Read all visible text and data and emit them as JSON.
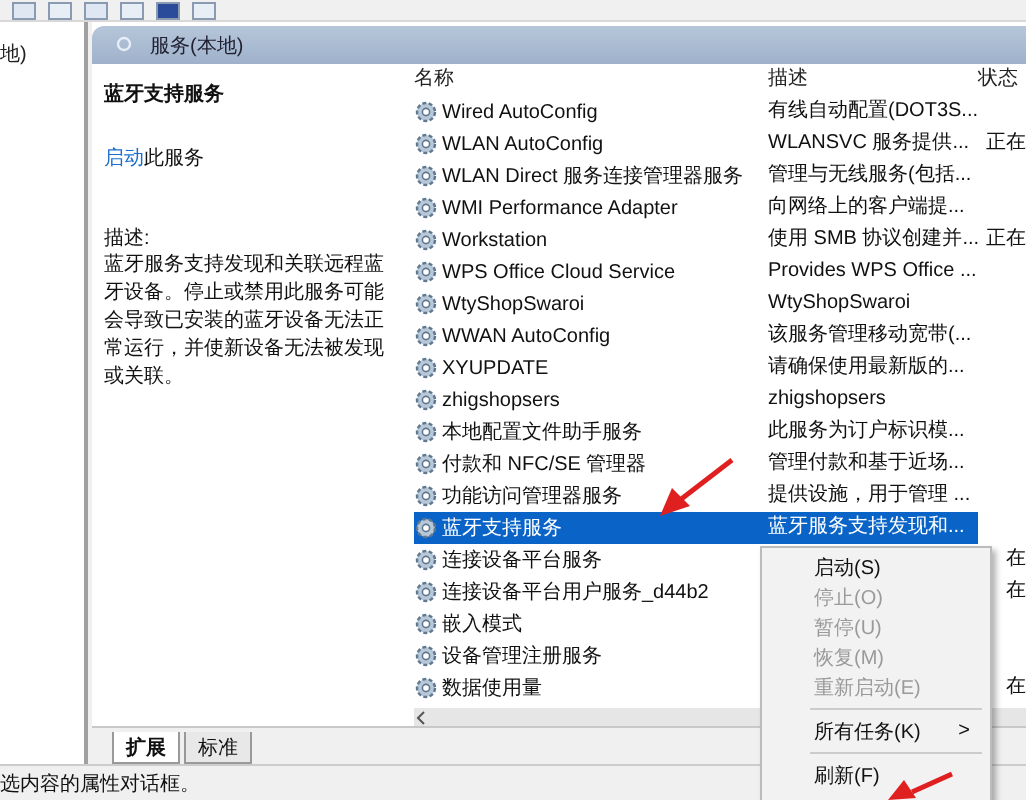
{
  "tree": {
    "label": "地)"
  },
  "header": {
    "title": "服务(本地)"
  },
  "detail": {
    "title": "蓝牙支持服务",
    "action_link": "启动",
    "action_rest": "此服务",
    "description_label": "描述:",
    "description": "蓝牙服务支持发现和关联远程蓝牙设备。停止或禁用此服务可能会导致已安装的蓝牙设备无法正常运行，并使新设备无法被发现或关联。"
  },
  "columns": [
    "名称",
    "描述",
    "状态"
  ],
  "rows": [
    {
      "name": "Wired AutoConfig",
      "description": "有线自动配置(DOT3S...",
      "status": "",
      "selected": false
    },
    {
      "name": "WLAN AutoConfig",
      "description": "WLANSVC 服务提供...",
      "status": "正在",
      "selected": false
    },
    {
      "name": "WLAN Direct 服务连接管理器服务",
      "description": "管理与无线服务(包括...",
      "status": "",
      "selected": false
    },
    {
      "name": "WMI Performance Adapter",
      "description": "向网络上的客户端提...",
      "status": "",
      "selected": false
    },
    {
      "name": "Workstation",
      "description": "使用 SMB 协议创建并...",
      "status": "正在",
      "selected": false
    },
    {
      "name": "WPS Office Cloud Service",
      "description": "Provides WPS Office ...",
      "status": "",
      "selected": false
    },
    {
      "name": "WtyShopSwaroi",
      "description": "WtyShopSwaroi",
      "status": "",
      "selected": false
    },
    {
      "name": "WWAN AutoConfig",
      "description": "该服务管理移动宽带(...",
      "status": "",
      "selected": false
    },
    {
      "name": "XYUPDATE",
      "description": "请确保使用最新版的...",
      "status": "",
      "selected": false
    },
    {
      "name": "zhigshopsers",
      "description": "zhigshopsers",
      "status": "",
      "selected": false
    },
    {
      "name": "本地配置文件助手服务",
      "description": "此服务为订户标识模...",
      "status": "",
      "selected": false
    },
    {
      "name": "付款和 NFC/SE 管理器",
      "description": "管理付款和基于近场...",
      "status": "",
      "selected": false
    },
    {
      "name": "功能访问管理器服务",
      "description": "提供设施，用于管理 ...",
      "status": "",
      "selected": false
    },
    {
      "name": "蓝牙支持服务",
      "description": "蓝牙服务支持发现和...",
      "status": "",
      "selected": true
    },
    {
      "name": "连接设备平台服务",
      "description": "",
      "status": "在",
      "selected": false
    },
    {
      "name": "连接设备平台用户服务_d44b2",
      "description": "",
      "status": "在",
      "selected": false
    },
    {
      "name": "嵌入模式",
      "description": "",
      "status": "",
      "selected": false
    },
    {
      "name": "设备管理注册服务",
      "description": "",
      "status": "",
      "selected": false
    },
    {
      "name": "数据使用量",
      "description": "",
      "status": "在",
      "selected": false
    }
  ],
  "bottom_tabs": [
    {
      "label": "扩展",
      "selected": true
    },
    {
      "label": "标准",
      "selected": false
    }
  ],
  "context_menu": [
    {
      "kind": "item",
      "label": "启动(S)",
      "disabled": false
    },
    {
      "kind": "item",
      "label": "停止(O)",
      "disabled": true
    },
    {
      "kind": "item",
      "label": "暂停(U)",
      "disabled": true
    },
    {
      "kind": "item",
      "label": "恢复(M)",
      "disabled": true
    },
    {
      "kind": "item",
      "label": "重新启动(E)",
      "disabled": true
    },
    {
      "kind": "separator"
    },
    {
      "kind": "submenu",
      "label": "所有任务(K)",
      "arrow": ">",
      "disabled": false
    },
    {
      "kind": "separator"
    },
    {
      "kind": "item",
      "label": "刷新(F)",
      "disabled": false
    }
  ],
  "status_bar": "选内容的属性对话框。"
}
